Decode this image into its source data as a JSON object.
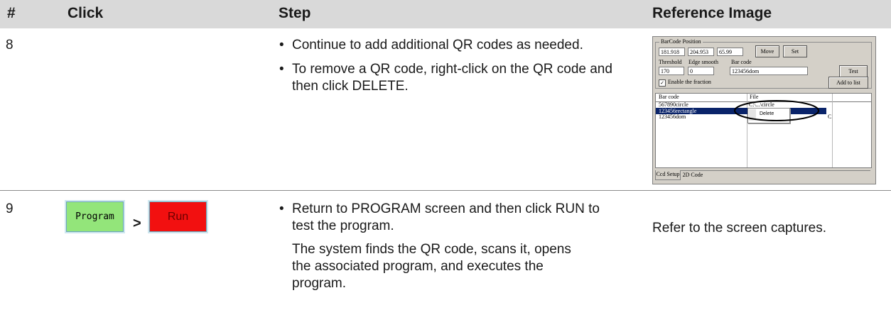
{
  "header": {
    "num": "#",
    "click": "Click",
    "step": "Step",
    "ref": "Reference Image"
  },
  "rows": [
    {
      "num": "8",
      "bullets": [
        "Continue to add additional QR codes as needed.",
        "To remove a QR code, right-click on the QR code and then click DELETE."
      ]
    },
    {
      "num": "9",
      "buttons": {
        "program": "Program",
        "sep": ">",
        "run": "Run"
      },
      "bullets": [
        "Return to PROGRAM screen and then click RUN to test the program."
      ],
      "paragraph": "The system finds the QR code, scans it, opens the associated program, and executes the program.",
      "reference": "Refer to the screen captures."
    }
  ],
  "screenshot": {
    "group_title": "BarCode Position",
    "pos": [
      "181.918",
      "204.953",
      "65.99"
    ],
    "move": "Move",
    "set": "Set",
    "threshold_label": "Threshold",
    "edge_label": "Edge smooth",
    "barcode_label": "Bar code",
    "threshold": "170",
    "edge": "0",
    "barcode": "123456dom",
    "test": "Test",
    "enable_label": "Enable the fraction",
    "enable_checked": "✓",
    "add": "Add to list",
    "col_barcode": "Bar code",
    "col_file": "File",
    "list_rows": [
      "567890circle",
      "123456rectangle",
      "123456dom"
    ],
    "file_rows": [
      "C:\\...\\circle",
      "",
      "C"
    ],
    "ctx_delete": "Delete",
    "tabs": [
      "Ccd Setup",
      "2D Code"
    ]
  }
}
